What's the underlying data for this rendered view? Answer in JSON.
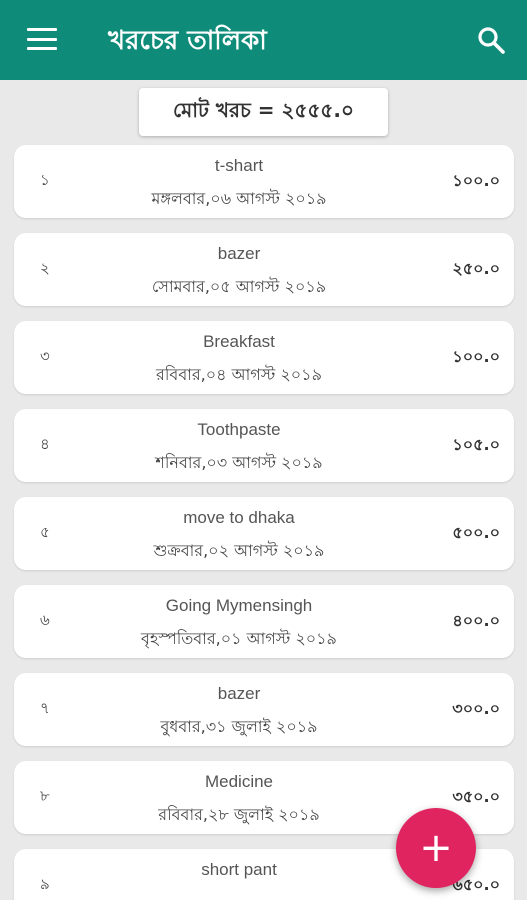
{
  "appbar": {
    "title": "খরচের তালিকা",
    "menu_icon": "menu-icon",
    "search_icon": "search-icon",
    "color": "#0e8c79"
  },
  "total": {
    "label": "মোট খরচ = ২৫৫৫.০"
  },
  "expenses": [
    {
      "index": "১",
      "name": "t-shart",
      "date": "মঙ্গলবার,০৬ আগস্ট ২০১৯",
      "amount": "১০০.০"
    },
    {
      "index": "২",
      "name": "bazer",
      "date": "সোমবার,০৫ আগস্ট ২০১৯",
      "amount": "২৫০.০"
    },
    {
      "index": "৩",
      "name": "Breakfast",
      "date": "রবিবার,০৪ আগস্ট ২০১৯",
      "amount": "১০০.০"
    },
    {
      "index": "৪",
      "name": "Toothpaste",
      "date": "শনিবার,০৩ আগস্ট ২০১৯",
      "amount": "১০৫.০"
    },
    {
      "index": "৫",
      "name": "move to dhaka",
      "date": "শুক্রবার,০২ আগস্ট ২০১৯",
      "amount": "৫০০.০"
    },
    {
      "index": "৬",
      "name": "Going Mymensingh",
      "date": "বৃহস্পতিবার,০১ আগস্ট ২০১৯",
      "amount": "৪০০.০"
    },
    {
      "index": "৭",
      "name": "bazer",
      "date": "বুধবার,৩১ জুলাই ২০১৯",
      "amount": "৩০০.০"
    },
    {
      "index": "৮",
      "name": "Medicine",
      "date": "রবিবার,২৮ জুলাই ২০১৯",
      "amount": "৩৫০.০"
    },
    {
      "index": "৯",
      "name": "short pant",
      "date": "",
      "amount": "৬৫০.০"
    }
  ],
  "fab": {
    "icon": "add-icon",
    "symbol": "+",
    "color": "#e0245f"
  }
}
